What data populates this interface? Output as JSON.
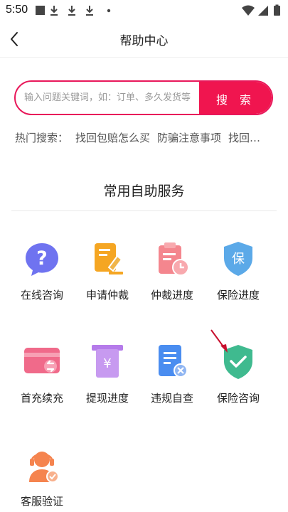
{
  "status": {
    "time": "5:50"
  },
  "header": {
    "title": "帮助中心"
  },
  "search": {
    "placeholder": "输入问题关键词，如：订单、多久发货等",
    "button_label": "搜 索"
  },
  "hot": {
    "label": "热门搜索：",
    "items": [
      "找回包赔怎么买",
      "防骗注意事项",
      "找回…"
    ]
  },
  "section": {
    "title": "常用自助服务"
  },
  "services": [
    {
      "label": "在线咨询",
      "icon": "chat-question-icon",
      "color": "#6f73f0"
    },
    {
      "label": "申请仲裁",
      "icon": "arbitration-doc-icon",
      "color": "#f5a623"
    },
    {
      "label": "仲裁进度",
      "icon": "clipboard-clock-icon",
      "color": "#f4868e"
    },
    {
      "label": "保险进度",
      "icon": "insurance-shield-icon",
      "color": "#5ba9e8"
    },
    {
      "label": "首充续充",
      "icon": "recharge-card-icon",
      "color": "#f06a8a"
    },
    {
      "label": "提现进度",
      "icon": "withdraw-icon",
      "color": "#b57bea"
    },
    {
      "label": "违规自查",
      "icon": "violation-check-icon",
      "color": "#4a8df0"
    },
    {
      "label": "保险咨询",
      "icon": "shield-check-icon",
      "color": "#3fba8f"
    },
    {
      "label": "客服验证",
      "icon": "agent-verify-icon",
      "color": "#f5844f"
    }
  ]
}
